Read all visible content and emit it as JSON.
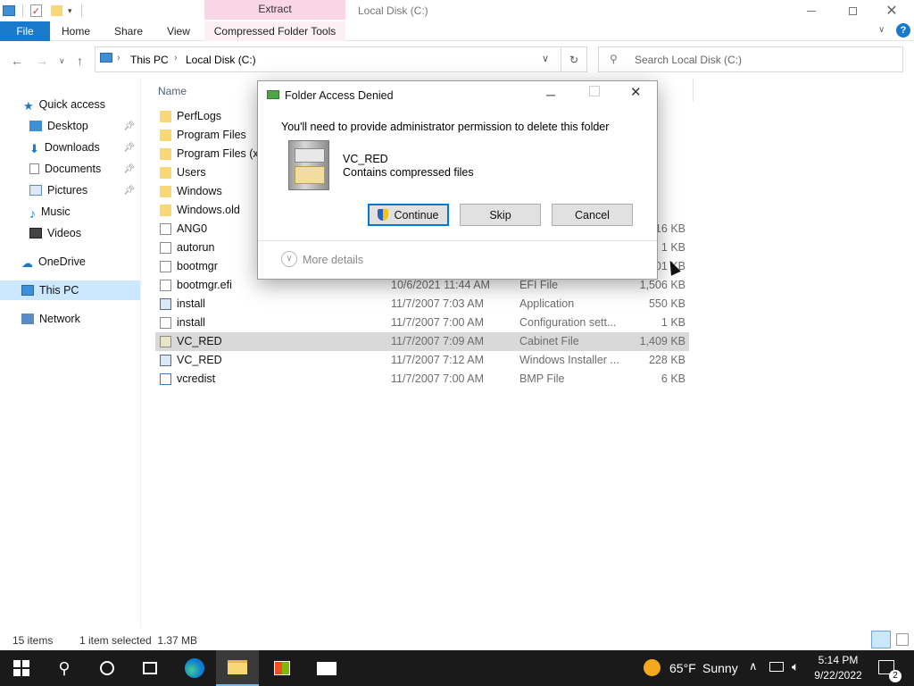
{
  "window": {
    "title": "Local Disk (C:)",
    "context_tab": "Extract"
  },
  "ribbon": {
    "tabs": [
      "File",
      "Home",
      "Share",
      "View"
    ],
    "context_group": "Compressed Folder Tools"
  },
  "address": {
    "segments": [
      "This PC",
      "Local Disk (C:)"
    ],
    "search_placeholder": "Search Local Disk (C:)"
  },
  "nav": {
    "items": [
      {
        "label": "Quick access",
        "icon": "star-icon"
      },
      {
        "label": "Desktop",
        "icon": "desktop-icon",
        "pinned": true
      },
      {
        "label": "Downloads",
        "icon": "download-arrow-icon",
        "pinned": true
      },
      {
        "label": "Documents",
        "icon": "documents-icon",
        "pinned": true
      },
      {
        "label": "Pictures",
        "icon": "pictures-icon",
        "pinned": true
      },
      {
        "label": "Music",
        "icon": "music-note-icon"
      },
      {
        "label": "Videos",
        "icon": "videos-icon"
      },
      {
        "label": "OneDrive",
        "icon": "cloud-icon"
      },
      {
        "label": "This PC",
        "icon": "computer-icon",
        "selected": true
      },
      {
        "label": "Network",
        "icon": "network-icon"
      }
    ]
  },
  "columns": {
    "name": "Name"
  },
  "files": [
    {
      "name": "PerfLogs",
      "date": "",
      "type": "",
      "size": "",
      "kind": "folder"
    },
    {
      "name": "Program Files",
      "date": "",
      "type": "",
      "size": "",
      "kind": "folder"
    },
    {
      "name": "Program Files (x8",
      "date": "",
      "type": "",
      "size": "",
      "kind": "folder"
    },
    {
      "name": "Users",
      "date": "",
      "type": "",
      "size": "",
      "kind": "folder"
    },
    {
      "name": "Windows",
      "date": "",
      "type": "",
      "size": "",
      "kind": "folder"
    },
    {
      "name": "Windows.old",
      "date": "",
      "type": "",
      "size": "",
      "kind": "folder"
    },
    {
      "name": "ANG0",
      "date": "",
      "type": "",
      "size": "316 KB",
      "kind": "file"
    },
    {
      "name": "autorun",
      "date": "",
      "type": "",
      "size": "1 KB",
      "kind": "file"
    },
    {
      "name": "bootmgr",
      "date": "",
      "type": "",
      "size": "401 KB",
      "kind": "file"
    },
    {
      "name": "bootmgr.efi",
      "date": "10/6/2021 11:44 AM",
      "type": "EFI File",
      "size": "1,506 KB",
      "kind": "file"
    },
    {
      "name": "install",
      "date": "11/7/2007 7:03 AM",
      "type": "Application",
      "size": "550 KB",
      "kind": "app"
    },
    {
      "name": "install",
      "date": "11/7/2007 7:00 AM",
      "type": "Configuration sett...",
      "size": "1 KB",
      "kind": "file"
    },
    {
      "name": "VC_RED",
      "date": "11/7/2007 7:09 AM",
      "type": "Cabinet File",
      "size": "1,409 KB",
      "kind": "cab",
      "selected": true
    },
    {
      "name": "VC_RED",
      "date": "11/7/2007 7:12 AM",
      "type": "Windows Installer ...",
      "size": "228 KB",
      "kind": "app"
    },
    {
      "name": "vcredist",
      "date": "11/7/2007 7:00 AM",
      "type": "BMP File",
      "size": "6 KB",
      "kind": "image"
    }
  ],
  "status": {
    "items": "15 items",
    "selection": "1 item selected  1.37 MB"
  },
  "dialog": {
    "title": "Folder Access Denied",
    "message": "You'll need to provide administrator permission to delete this folder",
    "item_name": "VC_RED",
    "item_desc": "Contains compressed files",
    "continue": "Continue",
    "skip": "Skip",
    "cancel": "Cancel",
    "more_details": "More details"
  },
  "taskbar": {
    "weather_temp": "65°F",
    "weather_desc": "Sunny",
    "time": "5:14 PM",
    "date": "9/22/2022",
    "notification_count": "2"
  },
  "colors": {
    "file_tab": "#1979ca",
    "context_tab": "#f9d5e5",
    "selection": "#cce8ff",
    "taskbar": "#1a1a1a"
  }
}
